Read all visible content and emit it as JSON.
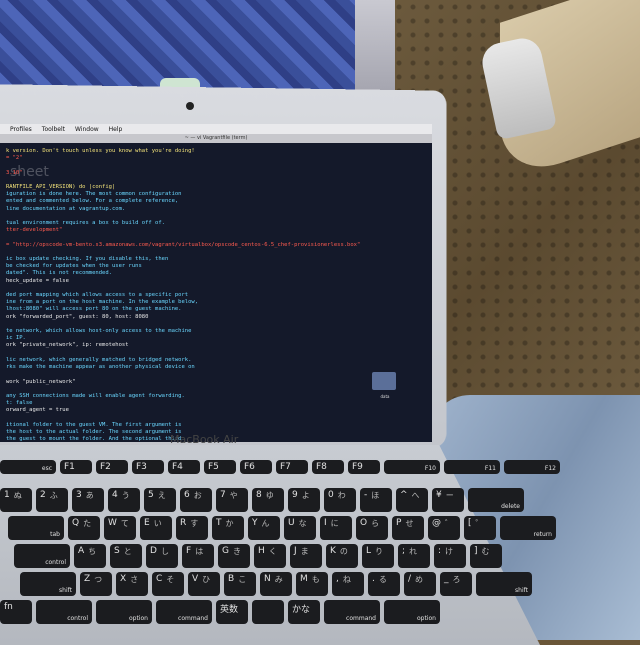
{
  "screen": {
    "menubar": [
      "Profiles",
      "Toolbelt",
      "Window",
      "Help"
    ],
    "title": "~ — vi Vagrantfile (term)",
    "watermark": "sheet",
    "terminal_lines": [
      {
        "text": "k version. Don't touch unless you know what you're doing!",
        "color": "c-yel"
      },
      {
        "text": "= \"2\"",
        "color": "c-red"
      },
      {
        "text": "",
        "color": ""
      },
      {
        "text": "3.10\"",
        "color": "c-red"
      },
      {
        "text": "",
        "color": ""
      },
      {
        "text": "RANTFILE_API_VERSION) do |config|",
        "color": "c-yel"
      },
      {
        "text": "iguration is done here. The most common configuration",
        "color": "c-cyn"
      },
      {
        "text": "ented and commented below. For a complete reference,",
        "color": "c-cyn"
      },
      {
        "text": "line documentation at vagrantup.com.",
        "color": "c-cyn"
      },
      {
        "text": "",
        "color": ""
      },
      {
        "text": "tual environment requires a box to build off of.",
        "color": "c-cyn"
      },
      {
        "text": "tter-development\"",
        "color": "c-red"
      },
      {
        "text": "",
        "color": ""
      },
      {
        "text": "= \"http://opscode-vm-bento.s3.amazonaws.com/vagrant/virtualbox/opscode_centos-6.5_chef-provisionerless.box\"",
        "color": "c-red"
      },
      {
        "text": "",
        "color": ""
      },
      {
        "text": "ic box update checking. If you disable this, then",
        "color": "c-cyn"
      },
      {
        "text": "be checked for updates when the user runs",
        "color": "c-cyn"
      },
      {
        "text": "dated\". This is not recommended.",
        "color": "c-cyn"
      },
      {
        "text": "heck_update = false",
        "color": ""
      },
      {
        "text": "",
        "color": ""
      },
      {
        "text": "ded port mapping which allows access to a specific port",
        "color": "c-cyn"
      },
      {
        "text": "ine from a port on the host machine. In the example below,",
        "color": "c-cyn"
      },
      {
        "text": "lhost:8080\" will access port 80 on the guest machine.",
        "color": "c-cyn"
      },
      {
        "text": "ork \"forwarded_port\", guest: 80, host: 8080",
        "color": ""
      },
      {
        "text": "",
        "color": ""
      },
      {
        "text": "te network, which allows host-only access to the machine",
        "color": "c-cyn"
      },
      {
        "text": "ic IP.",
        "color": "c-cyn"
      },
      {
        "text": "ork \"private_network\", ip: remotehost",
        "color": ""
      },
      {
        "text": "",
        "color": ""
      },
      {
        "text": "lic network, which generally matched to bridged network.",
        "color": "c-cyn"
      },
      {
        "text": "rks make the machine appear as another physical device on",
        "color": "c-cyn"
      },
      {
        "text": "",
        "color": ""
      },
      {
        "text": "work \"public_network\"",
        "color": ""
      },
      {
        "text": "",
        "color": ""
      },
      {
        "text": "any SSH connections made will enable agent forwarding.",
        "color": "c-cyn"
      },
      {
        "text": "t: false",
        "color": "c-cyn"
      },
      {
        "text": "orward_agent = true",
        "color": ""
      },
      {
        "text": "",
        "color": ""
      },
      {
        "text": "itional folder to the guest VM. The first argument is",
        "color": "c-cyn"
      },
      {
        "text": "the host to the actual folder. The second argument is",
        "color": "c-cyn"
      },
      {
        "text": "the guest to mount the folder. And the optional third",
        "color": "c-cyn"
      },
      {
        "text": "a set of non-required options.",
        "color": "c-cyn"
      },
      {
        "text": "ynced_folder \"../data\", \"/vagrant_data\"",
        "color": ""
      }
    ],
    "folder_label": "data"
  },
  "brand": "MacBook Air",
  "keyboard": {
    "rows": [
      [
        {
          "l": "esc"
        },
        {
          "l": "F1"
        },
        {
          "l": "F2"
        },
        {
          "l": "F3"
        },
        {
          "l": "F4"
        },
        {
          "l": "F5"
        },
        {
          "l": "F6"
        },
        {
          "l": "F7"
        },
        {
          "l": "F8"
        },
        {
          "l": "F9"
        },
        {
          "l": "F10"
        },
        {
          "l": "F11"
        },
        {
          "l": "F12"
        }
      ],
      [
        {
          "l": "1",
          "k": "ぬ"
        },
        {
          "l": "2",
          "k": "ふ"
        },
        {
          "l": "3",
          "k": "あ"
        },
        {
          "l": "4",
          "k": "う"
        },
        {
          "l": "5",
          "k": "え"
        },
        {
          "l": "6",
          "k": "お"
        },
        {
          "l": "7",
          "k": "や"
        },
        {
          "l": "8",
          "k": "ゆ"
        },
        {
          "l": "9",
          "k": "よ"
        },
        {
          "l": "0",
          "k": "わ"
        },
        {
          "l": "-",
          "k": "ほ"
        },
        {
          "l": "^",
          "k": "へ"
        },
        {
          "l": "¥",
          "k": "ー"
        },
        {
          "l": "delete"
        }
      ],
      [
        {
          "l": "tab"
        },
        {
          "l": "Q",
          "k": "た"
        },
        {
          "l": "W",
          "k": "て"
        },
        {
          "l": "E",
          "k": "い"
        },
        {
          "l": "R",
          "k": "す"
        },
        {
          "l": "T",
          "k": "か"
        },
        {
          "l": "Y",
          "k": "ん"
        },
        {
          "l": "U",
          "k": "な"
        },
        {
          "l": "I",
          "k": "に"
        },
        {
          "l": "O",
          "k": "ら"
        },
        {
          "l": "P",
          "k": "せ"
        },
        {
          "l": "@",
          "k": "゛"
        },
        {
          "l": "[",
          "k": "゜"
        },
        {
          "l": "return"
        }
      ],
      [
        {
          "l": "control"
        },
        {
          "l": "A",
          "k": "ち"
        },
        {
          "l": "S",
          "k": "と"
        },
        {
          "l": "D",
          "k": "し"
        },
        {
          "l": "F",
          "k": "は"
        },
        {
          "l": "G",
          "k": "き"
        },
        {
          "l": "H",
          "k": "く"
        },
        {
          "l": "J",
          "k": "ま"
        },
        {
          "l": "K",
          "k": "の"
        },
        {
          "l": "L",
          "k": "り"
        },
        {
          "l": ";",
          "k": "れ"
        },
        {
          "l": ":",
          "k": "け"
        },
        {
          "l": "]",
          "k": "む"
        }
      ],
      [
        {
          "l": "shift"
        },
        {
          "l": "Z",
          "k": "つ"
        },
        {
          "l": "X",
          "k": "さ"
        },
        {
          "l": "C",
          "k": "そ"
        },
        {
          "l": "V",
          "k": "ひ"
        },
        {
          "l": "B",
          "k": "こ"
        },
        {
          "l": "N",
          "k": "み"
        },
        {
          "l": "M",
          "k": "も"
        },
        {
          "l": ",",
          "k": "ね"
        },
        {
          "l": ".",
          "k": "る"
        },
        {
          "l": "/",
          "k": "め"
        },
        {
          "l": "_",
          "k": "ろ"
        },
        {
          "l": "shift"
        }
      ],
      [
        {
          "l": "fn"
        },
        {
          "l": "control"
        },
        {
          "l": "option"
        },
        {
          "l": "command"
        },
        {
          "l": "英数"
        },
        {
          "l": ""
        },
        {
          "l": "かな"
        },
        {
          "l": "command"
        },
        {
          "l": "option"
        }
      ]
    ]
  }
}
